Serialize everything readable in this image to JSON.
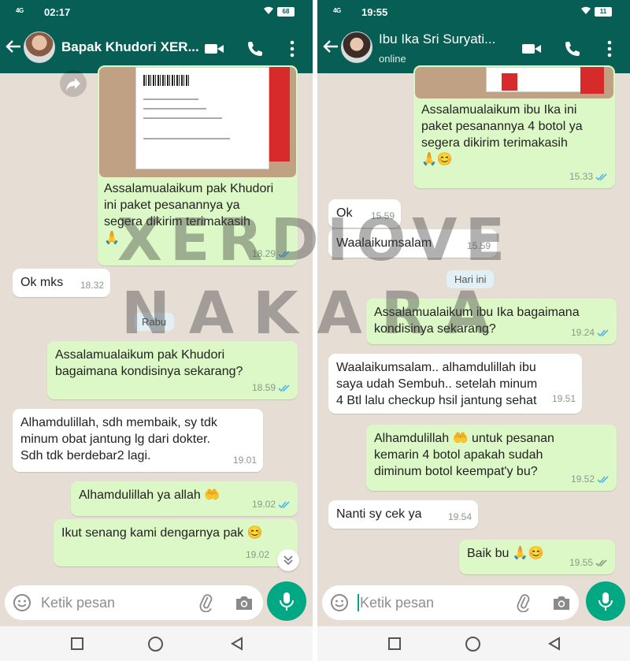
{
  "left": {
    "status": {
      "network": "4G",
      "time": "02:17",
      "battery": "68"
    },
    "header": {
      "name": "Bapak Khudori XER..."
    },
    "messages": [
      {
        "text": "Assalamualaikum pak Khudori\nini paket pesanannya ya\nsegera dikirim terimakasih\n🙏",
        "time": "18.29"
      },
      {
        "text": "Ok mks",
        "time": "18.32"
      },
      {
        "text": "Assalamualaikum pak Khudori\nbagaimana kondisinya sekarang?",
        "time": "18.59"
      },
      {
        "text": "Alhamdulillah, sdh membaik, sy tdk\nminum obat jantung lg dari dokter.\nSdh tdk berdebar2 lagi.",
        "time": "19.01"
      },
      {
        "text": "Alhamdulillah ya allah 🤲",
        "time": "19.02"
      },
      {
        "text": "Ikut senang kami dengarnya pak 😊",
        "time": "19.02"
      }
    ],
    "day_label": "Rabu",
    "input": {
      "placeholder": "Ketik pesan"
    }
  },
  "right": {
    "status": {
      "network": "4G",
      "time": "19:55",
      "battery": "11"
    },
    "header": {
      "name": "Ibu Ika Sri Suryati...",
      "status": "online"
    },
    "messages": [
      {
        "text": "Assalamualaikum ibu Ika ini\npaket pesanannya 4 botol ya\nsegera dikirim terimakasih\n🙏😊",
        "time": "15.33"
      },
      {
        "text": "Ok",
        "time": "15.59"
      },
      {
        "text": "Waalaikumsalam",
        "time": "15.59"
      },
      {
        "text": "Assalamualaikum ibu Ika bagaimana\nkondisinya sekarang?",
        "time": "19.24"
      },
      {
        "text": "Waalaikumsalam.. alhamdulillah ibu\nsaya udah Sembuh.. setelah minum\n4 Btl lalu checkup hsil jantung sehat",
        "time": "19.51"
      },
      {
        "text": "Alhamdulillah 🤲 untuk pesanan\nkemarin 4 botol apakah sudah\ndiminum botol keempat'y bu?",
        "time": "19.52"
      },
      {
        "text": "Nanti sy cek ya",
        "time": "19.54"
      },
      {
        "text": "Baik bu 🙏😊",
        "time": "19.55"
      }
    ],
    "day_label": "Hari ini",
    "input": {
      "placeholder": "Ketik pesan"
    }
  },
  "watermark": {
    "line1": "XERDIOVE",
    "line2": "NAKARA"
  },
  "colors": {
    "header": "#075e54",
    "outgoing": "#dcf8c6",
    "incoming": "#ffffff",
    "accent": "#00a884",
    "read_ticks": "#4fb6ec"
  }
}
